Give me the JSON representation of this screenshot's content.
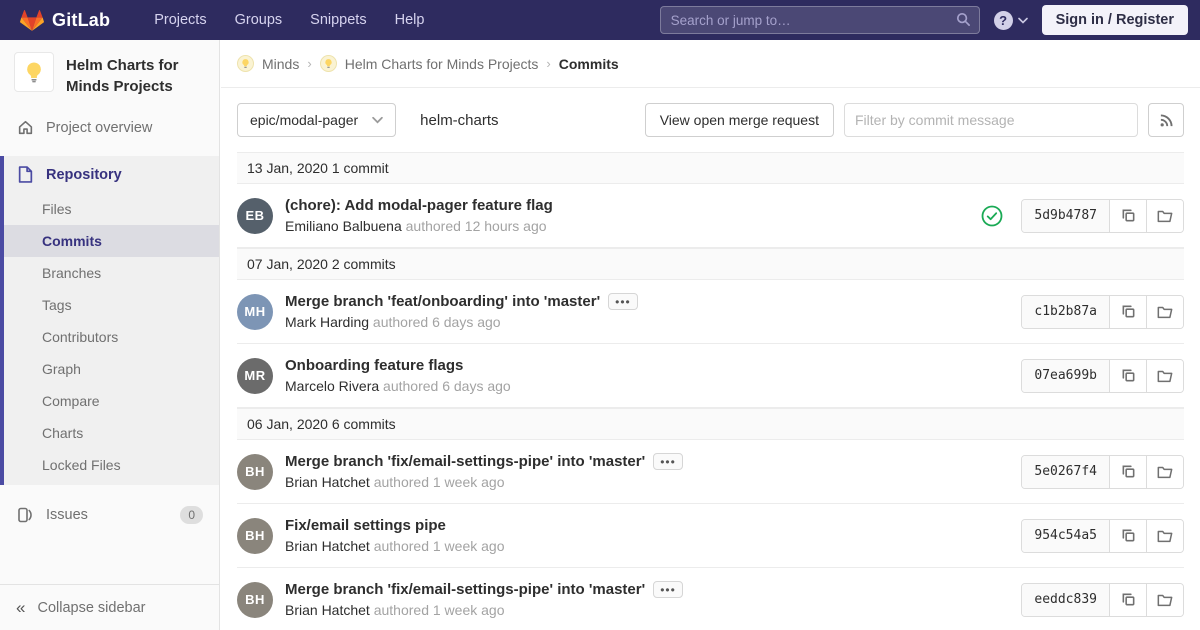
{
  "navbar": {
    "logo_text": "GitLab",
    "menu": [
      "Projects",
      "Groups",
      "Snippets",
      "Help"
    ],
    "search_placeholder": "Search or jump to…",
    "help_glyph": "?",
    "sign_in_label": "Sign in / Register"
  },
  "sidebar": {
    "project_title": "Helm Charts for Minds Projects",
    "overview_label": "Project overview",
    "repository_label": "Repository",
    "repo_items": [
      "Files",
      "Commits",
      "Branches",
      "Tags",
      "Contributors",
      "Graph",
      "Compare",
      "Charts",
      "Locked Files"
    ],
    "active_repo_item": "Commits",
    "issues_label": "Issues",
    "issues_count": "0",
    "collapse_label": "Collapse sidebar",
    "collapse_glyph": "«"
  },
  "breadcrumb": {
    "items": [
      "Minds",
      "Helm Charts for Minds Projects"
    ],
    "separator": "›",
    "current": "Commits"
  },
  "toolbar": {
    "branch_selector_value": "epic/modal-pager",
    "project_path": "helm-charts",
    "merge_request_button": "View open merge request",
    "filter_placeholder": "Filter by commit message"
  },
  "commits": {
    "groups": [
      {
        "date_header": "13 Jan, 2020 1 commit",
        "commits": [
          {
            "title": "(chore): Add modal-pager feature flag",
            "author": "Emiliano Balbuena",
            "meta": "authored 12 hours ago",
            "sha": "5d9b4787",
            "initials": "EB",
            "avatar_color": "#55606b",
            "pipeline_passed": true,
            "has_description": false
          }
        ]
      },
      {
        "date_header": "07 Jan, 2020 2 commits",
        "commits": [
          {
            "title": "Merge branch 'feat/onboarding' into 'master'",
            "author": "Mark Harding",
            "meta": "authored 6 days ago",
            "sha": "c1b2b87a",
            "initials": "MH",
            "avatar_color": "#7d95b5",
            "pipeline_passed": false,
            "has_description": true
          },
          {
            "title": "Onboarding feature flags",
            "author": "Marcelo Rivera",
            "meta": "authored 6 days ago",
            "sha": "07ea699b",
            "initials": "MR",
            "avatar_color": "#6b6b6b",
            "pipeline_passed": false,
            "has_description": false
          }
        ]
      },
      {
        "date_header": "06 Jan, 2020 6 commits",
        "commits": [
          {
            "title": "Merge branch 'fix/email-settings-pipe' into 'master'",
            "author": "Brian Hatchet",
            "meta": "authored 1 week ago",
            "sha": "5e0267f4",
            "initials": "BH",
            "avatar_color": "#8a857c",
            "pipeline_passed": false,
            "has_description": true
          },
          {
            "title": "Fix/email settings pipe",
            "author": "Brian Hatchet",
            "meta": "authored 1 week ago",
            "sha": "954c54a5",
            "initials": "BH",
            "avatar_color": "#8a857c",
            "pipeline_passed": false,
            "has_description": false
          },
          {
            "title": "Merge branch 'fix/email-settings-pipe' into 'master'",
            "author": "Brian Hatchet",
            "meta": "authored 1 week ago",
            "sha": "eeddc839",
            "initials": "BH",
            "avatar_color": "#8a857c",
            "pipeline_passed": false,
            "has_description": true
          }
        ]
      }
    ]
  },
  "colors": {
    "navbar_bg": "#2e2b5f",
    "accent_purple": "#4b4ba3",
    "active_text": "#37327f",
    "success_green": "#1aaa55",
    "bulb_yellow": "#fdd663"
  }
}
